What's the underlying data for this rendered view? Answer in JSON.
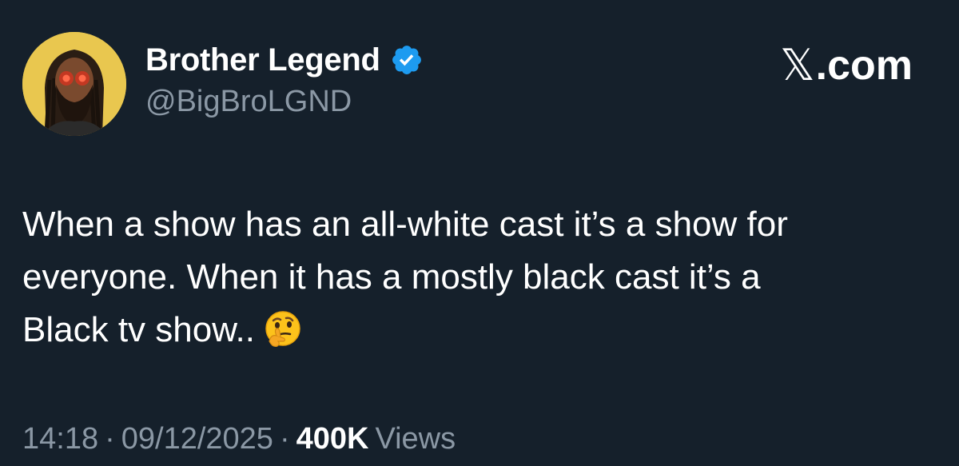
{
  "user": {
    "display_name": "Brother Legend",
    "handle": "@BigBroLGND",
    "verified": true,
    "verified_color": "#1d9bf0",
    "avatar_icon": "avatar-glowing-eyes-portrait"
  },
  "site": {
    "mark": "𝕏",
    "label": ".com"
  },
  "tweet": {
    "lines": [
      "When a show has an all-white cast it’s a show for",
      "everyone. When it has a mostly black cast it’s a",
      "Black tv show.."
    ],
    "emoji": "thinking-face-emoji"
  },
  "meta": {
    "time": "14:18",
    "separator": "·",
    "date": "09/12/2025",
    "views_count": "400K",
    "views_label": "Views"
  },
  "colors": {
    "background": "#15202b",
    "text": "#ffffff",
    "secondary_text": "#8b98a5",
    "avatar_background": "#e9c74f"
  }
}
